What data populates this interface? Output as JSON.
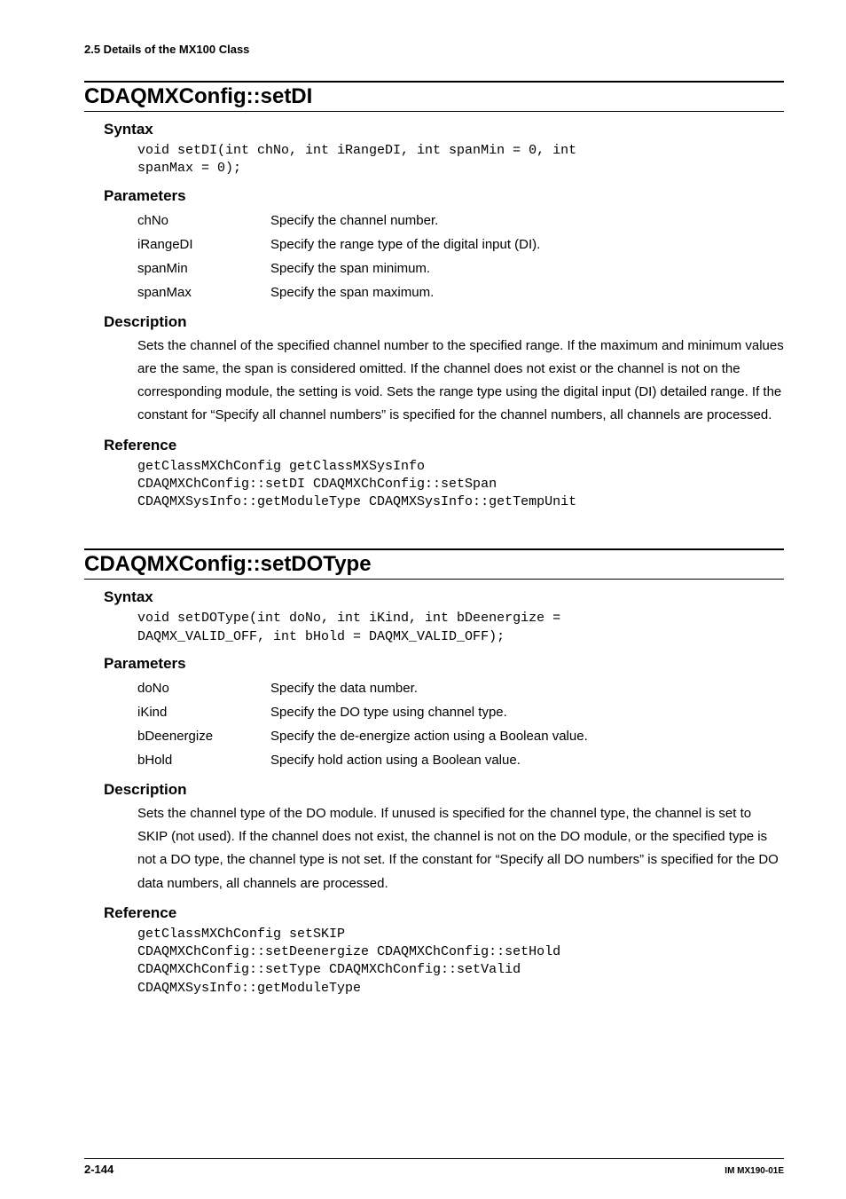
{
  "runningHead": "2.5  Details of the MX100 Class",
  "topics": [
    {
      "title": "CDAQMXConfig::setDI",
      "syntax": "void setDI(int chNo, int iRangeDI, int spanMin = 0, int\nspanMax = 0);",
      "params": [
        {
          "name": "chNo",
          "desc": "Specify the channel number."
        },
        {
          "name": "iRangeDI",
          "desc": "Specify the range type of the digital input (DI)."
        },
        {
          "name": "spanMin",
          "desc": "Specify the span minimum."
        },
        {
          "name": "spanMax",
          "desc": "Specify the span maximum."
        }
      ],
      "description": "Sets the channel of the specified channel number to the specified range.\nIf the maximum and minimum values are the same, the span is considered omitted.\nIf the channel does not exist or the channel is not on the corresponding module, the setting is void.  Sets the range type using the digital input (DI) detailed range.\nIf the constant for “Specify all channel numbers” is specified for the channel numbers, all channels are processed.",
      "reference": "getClassMXChConfig getClassMXSysInfo\nCDAQMXChConfig::setDI CDAQMXChConfig::setSpan\nCDAQMXSysInfo::getModuleType CDAQMXSysInfo::getTempUnit"
    },
    {
      "title": "CDAQMXConfig::setDOType",
      "syntax": "void setDOType(int doNo, int iKind, int bDeenergize =\nDAQMX_VALID_OFF, int bHold = DAQMX_VALID_OFF);",
      "params": [
        {
          "name": "doNo",
          "desc": "Specify the data number."
        },
        {
          "name": "iKind",
          "desc": "Specify the DO type using channel type."
        },
        {
          "name": "bDeenergize",
          "desc": "Specify the de-energize action using a Boolean value."
        },
        {
          "name": "bHold",
          "desc": "Specify hold action using a Boolean value."
        }
      ],
      "description": "Sets the channel type of the DO module.\nIf unused is specified for the channel type, the channel is set to SKIP (not used).\nIf the channel does not exist, the channel is not on the DO module, or the specified type is not a DO type, the channel type is not set.  If the constant for “Specify all DO numbers” is specified for the DO data numbers, all channels are processed.",
      "reference": "getClassMXChConfig setSKIP\nCDAQMXChConfig::setDeenergize CDAQMXChConfig::setHold\nCDAQMXChConfig::setType CDAQMXChConfig::setValid\nCDAQMXSysInfo::getModuleType"
    }
  ],
  "labels": {
    "syntax": "Syntax",
    "parameters": "Parameters",
    "description": "Description",
    "reference": "Reference"
  },
  "footer": {
    "pageNum": "2-144",
    "docId": "IM MX190-01E"
  }
}
